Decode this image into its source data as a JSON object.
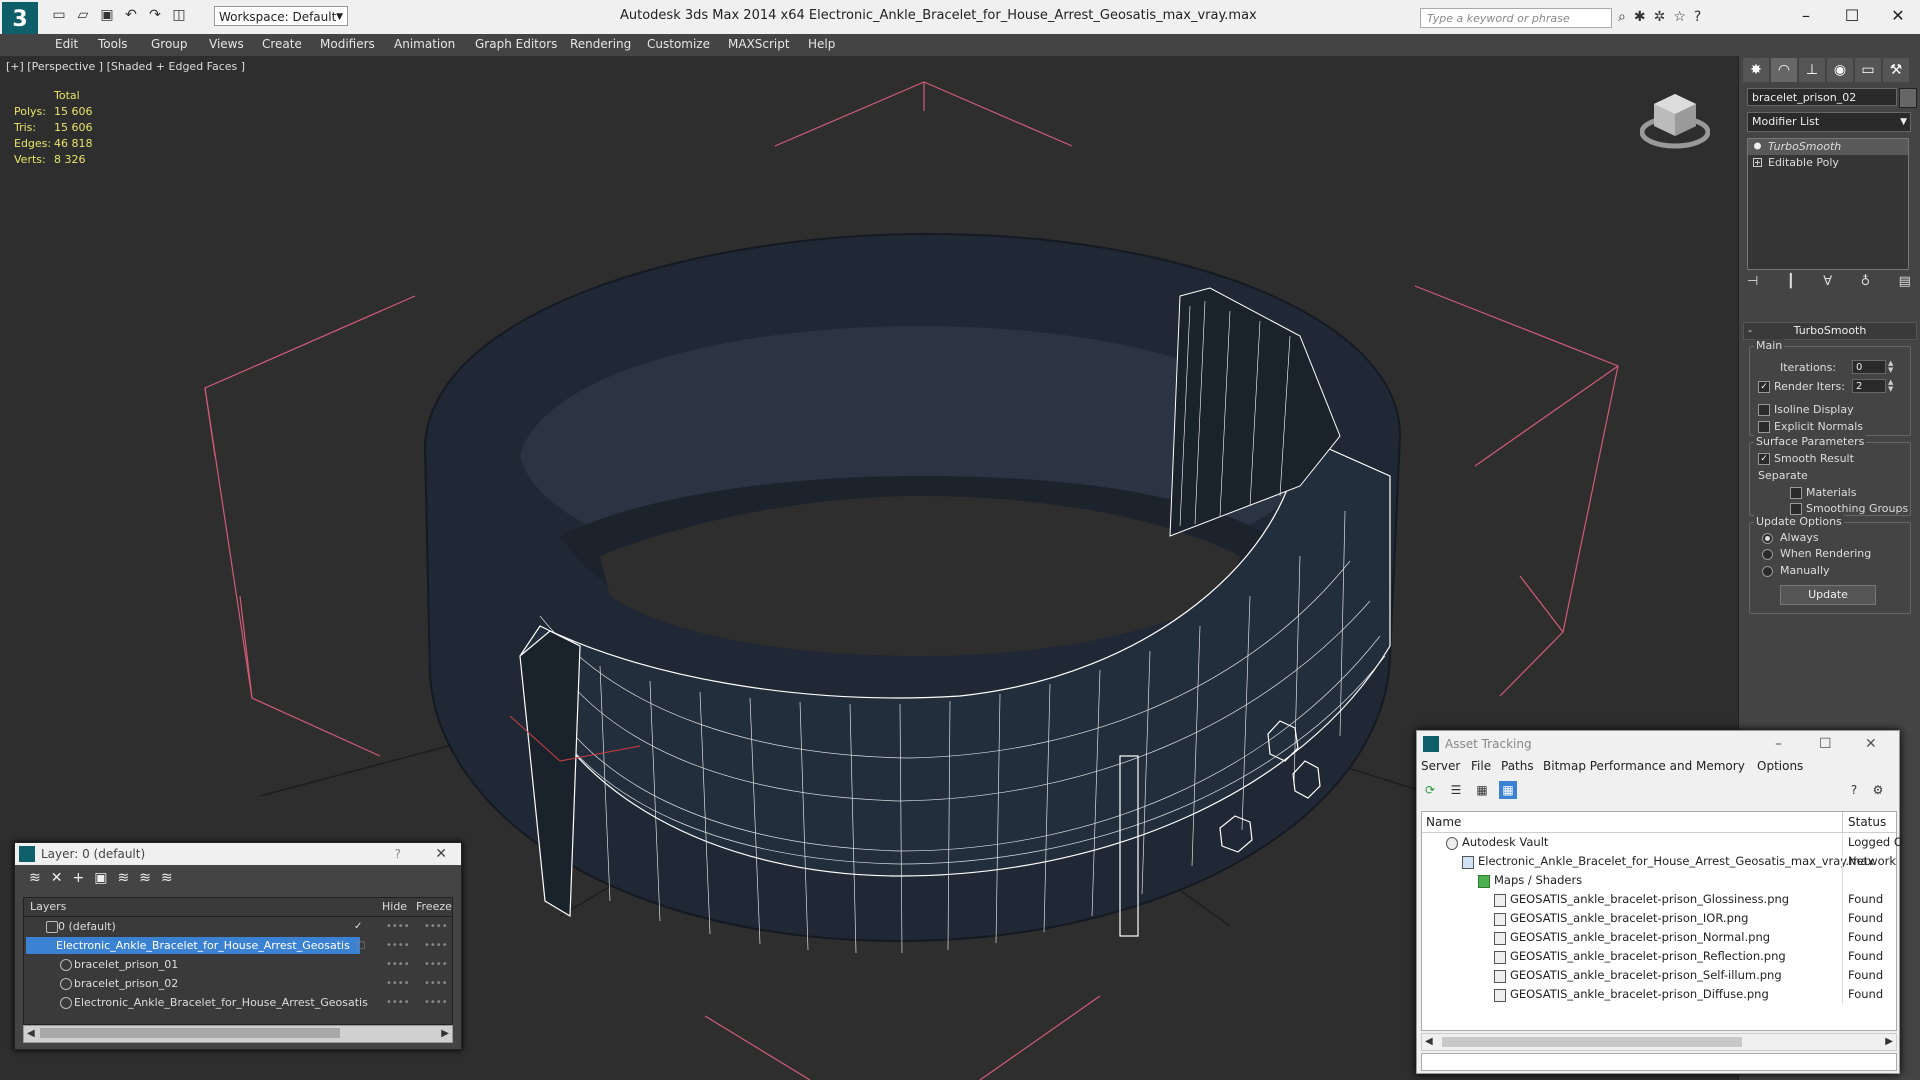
{
  "app": {
    "title": "Autodesk 3ds Max  2014 x64     Electronic_Ankle_Bracelet_for_House_Arrest_Geosatis_max_vray.max",
    "logo_letter": "3",
    "workspace": "Workspace: Default",
    "search_placeholder": "Type a keyword or phrase"
  },
  "menu": [
    "Edit",
    "Tools",
    "Group",
    "Views",
    "Create",
    "Modifiers",
    "Animation",
    "Graph Editors",
    "Rendering",
    "Customize",
    "MAXScript",
    "Help"
  ],
  "viewport": {
    "label": "[+] [Perspective ] [Shaded + Edged Faces ]",
    "stats": {
      "header": "Total",
      "rows": [
        {
          "k": "Polys:",
          "v": "15 606"
        },
        {
          "k": "Tris:",
          "v": "15 606"
        },
        {
          "k": "Edges:",
          "v": "46 818"
        },
        {
          "k": "Verts:",
          "v": "8 326"
        }
      ]
    }
  },
  "command_panel": {
    "object_name": "bracelet_prison_02",
    "modifier_list": "Modifier List",
    "stack": [
      "TurboSmooth",
      "Editable Poly"
    ],
    "rollout_title": "TurboSmooth",
    "main_label": "Main",
    "iterations_label": "Iterations:",
    "iterations_value": "0",
    "render_iters_label": "Render Iters:",
    "render_iters_value": "2",
    "isoline_label": "Isoline Display",
    "explicit_normals_label": "Explicit Normals",
    "surface_params_label": "Surface Parameters",
    "smooth_result_label": "Smooth Result",
    "separate_label": "Separate",
    "materials_label": "Materials",
    "smoothing_groups_label": "Smoothing Groups",
    "update_options_label": "Update Options",
    "always_label": "Always",
    "when_rendering_label": "When Rendering",
    "manually_label": "Manually",
    "update_button": "Update"
  },
  "layer_window": {
    "title": "Layer: 0 (default)",
    "help": "?",
    "columns": {
      "layers": "Layers",
      "hide": "Hide",
      "freeze": "Freeze"
    },
    "rows": [
      {
        "name": "0 (default)",
        "indent": 1,
        "selected": false
      },
      {
        "name": "Electronic_Ankle_Bracelet_for_House_Arrest_Geosatis",
        "indent": 1,
        "selected": true
      },
      {
        "name": "bracelet_prison_01",
        "indent": 2,
        "selected": false
      },
      {
        "name": "bracelet_prison_02",
        "indent": 2,
        "selected": false
      },
      {
        "name": "Electronic_Ankle_Bracelet_for_House_Arrest_Geosatis",
        "indent": 2,
        "selected": false
      }
    ]
  },
  "asset_window": {
    "title": "Asset Tracking",
    "menu": [
      "Server",
      "File",
      "Paths",
      "Bitmap Performance and Memory",
      "Options"
    ],
    "columns": {
      "name": "Name",
      "status": "Status"
    },
    "rows": [
      {
        "name": "Autodesk Vault",
        "status": "Logged O",
        "indent": 1
      },
      {
        "name": "Electronic_Ankle_Bracelet_for_House_Arrest_Geosatis_max_vray.max",
        "status": "Network",
        "indent": 2
      },
      {
        "name": "Maps / Shaders",
        "status": "",
        "indent": 3
      },
      {
        "name": "GEOSATIS_ankle_bracelet-prison_Glossiness.png",
        "status": "Found",
        "indent": 4
      },
      {
        "name": "GEOSATIS_ankle_bracelet-prison_IOR.png",
        "status": "Found",
        "indent": 4
      },
      {
        "name": "GEOSATIS_ankle_bracelet-prison_Normal.png",
        "status": "Found",
        "indent": 4
      },
      {
        "name": "GEOSATIS_ankle_bracelet-prison_Reflection.png",
        "status": "Found",
        "indent": 4
      },
      {
        "name": "GEOSATIS_ankle_bracelet-prison_Self-illum.png",
        "status": "Found",
        "indent": 4
      },
      {
        "name": "GEOSATIS_ankle_bracelet-prison_Diffuse.png",
        "status": "Found",
        "indent": 4
      }
    ]
  },
  "colors": {
    "accent": "#3c82d2",
    "stats_text": "#e8e36a",
    "viewport_bg": "#2e2e2e",
    "box_gizmo": "#d05a7a"
  }
}
